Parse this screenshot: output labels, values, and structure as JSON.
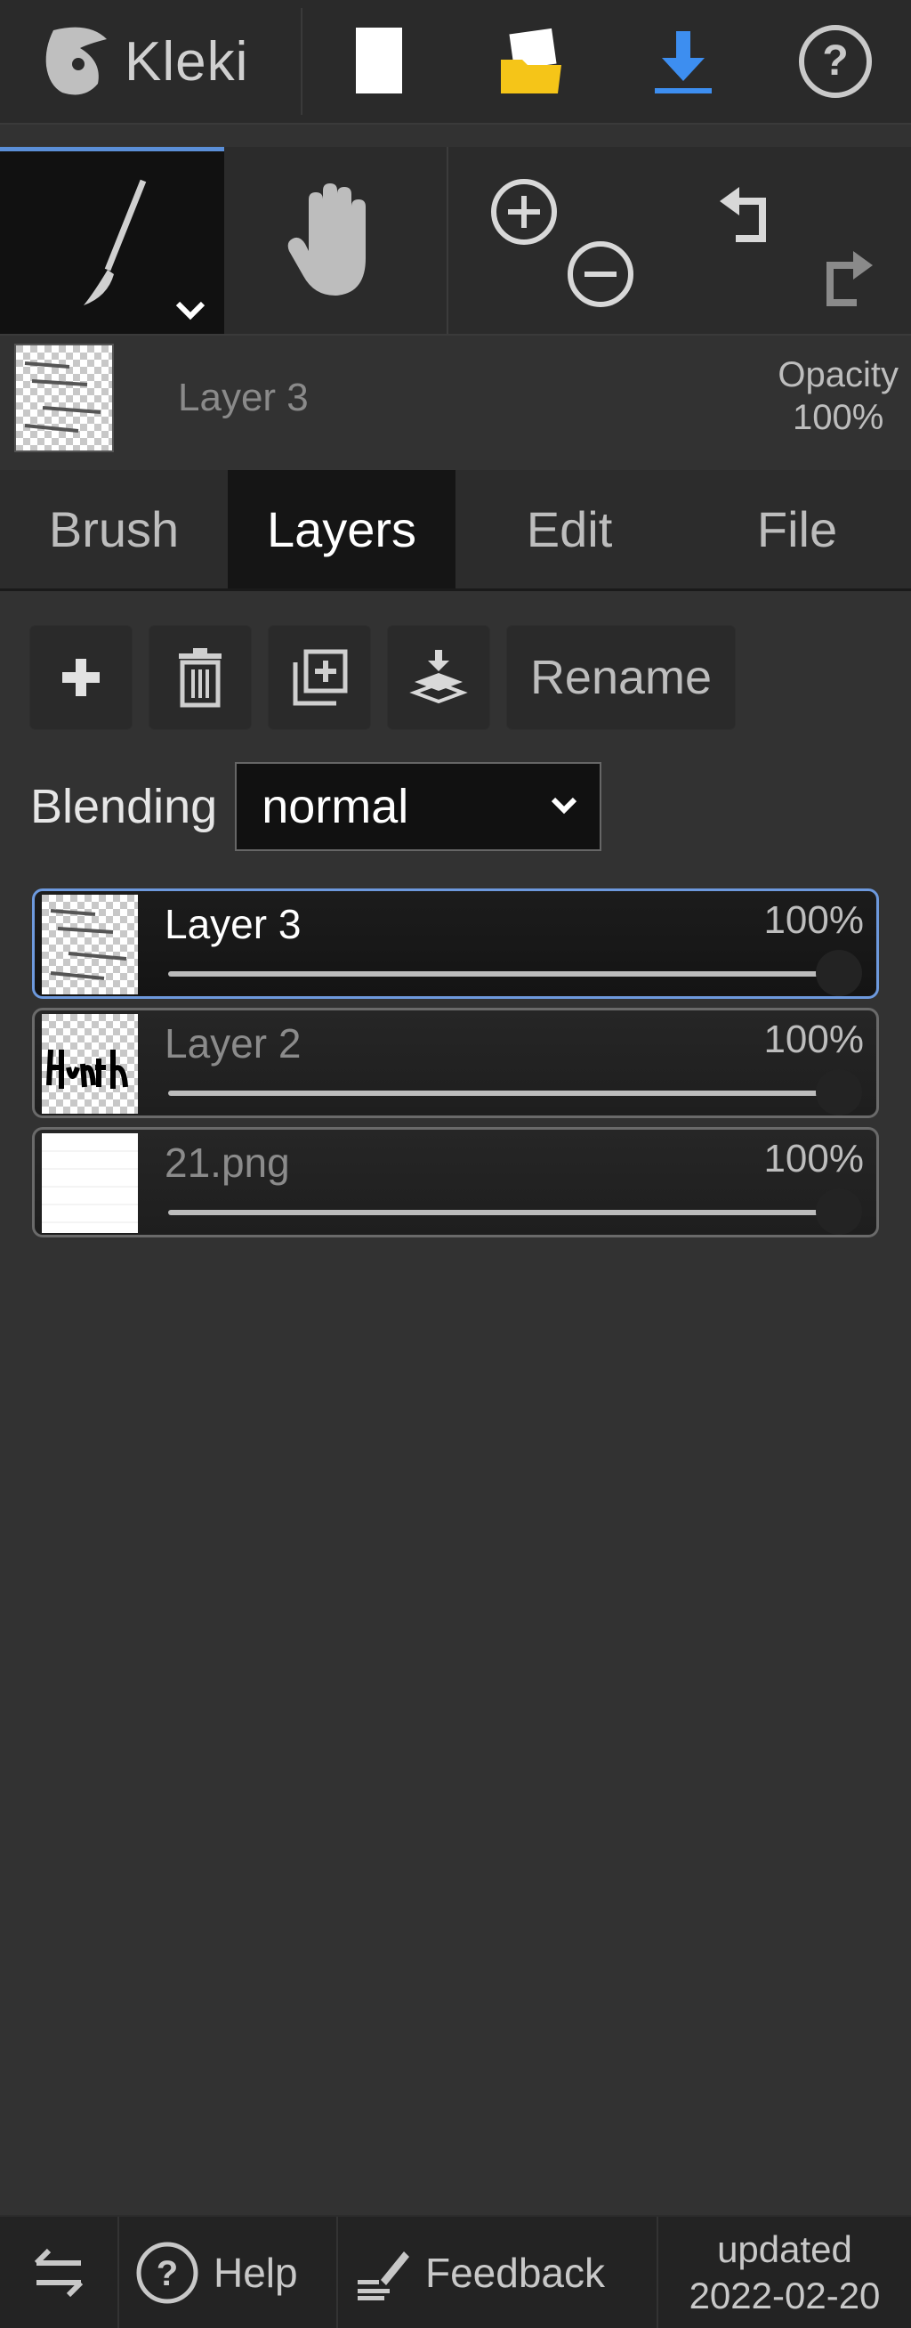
{
  "app": {
    "logo_text": "Kleki"
  },
  "topbar": {
    "icons": [
      "new-image-icon",
      "open-folder-icon",
      "download-icon",
      "help-icon"
    ]
  },
  "colors": {
    "accent": "#5b8fd8",
    "folder": "#f5c518",
    "download": "#3d8ef0"
  },
  "current_layer": {
    "name": "Layer 3",
    "opacity_label": "Opacity",
    "opacity_value": "100%"
  },
  "tabs": [
    {
      "label": "Brush"
    },
    {
      "label": "Layers"
    },
    {
      "label": "Edit"
    },
    {
      "label": "File"
    }
  ],
  "layer_actions": {
    "rename_label": "Rename"
  },
  "blending": {
    "label": "Blending",
    "value": "normal"
  },
  "layers": [
    {
      "name": "Layer 3",
      "opacity": "100%",
      "active": true
    },
    {
      "name": "Layer 2",
      "opacity": "100%",
      "active": false
    },
    {
      "name": "21.png",
      "opacity": "100%",
      "active": false
    }
  ],
  "footer": {
    "help_label": "Help",
    "feedback_label": "Feedback",
    "updated_line1": "updated",
    "updated_line2": "2022-02-20"
  }
}
